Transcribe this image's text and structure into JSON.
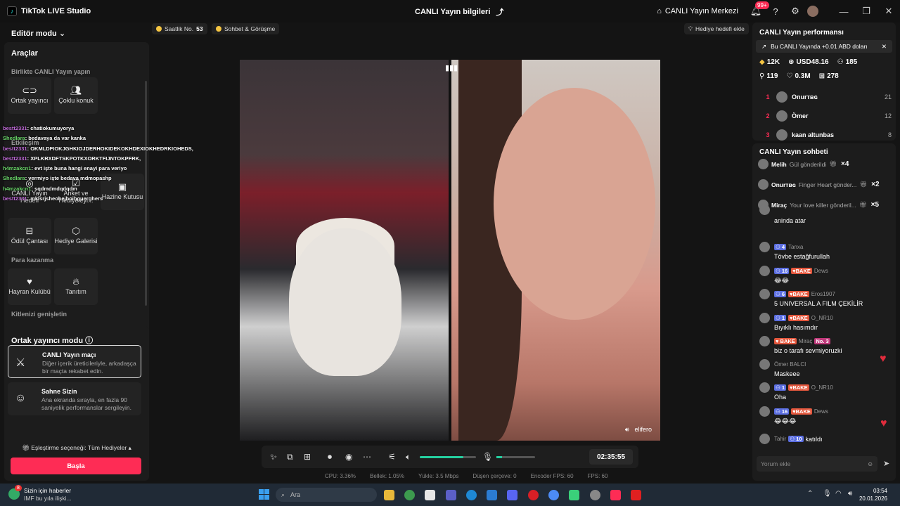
{
  "titlebar": {
    "app": "TikTok LIVE Studio",
    "center": "CANLI Yayın bilgileri",
    "live_center": "CANLI Yayın Merkezi",
    "notif_badge": "99+"
  },
  "left": {
    "mode": "Editör modu",
    "tools_title": "Araçlar",
    "sec_together": "Birlikte CANLI Yayın yapın",
    "tile_cohost": "Ortak yayıncı",
    "tile_multi": "Çoklu konuk",
    "sec_engage": "Etkileşim",
    "tile_goal": "CANLI Yayın Hedefi",
    "tile_poll": "Anket ve Hediyeleyi...",
    "tile_treasure": "Hazine Kutusu",
    "tile_reward": "Ödül Çantası",
    "tile_gallery": "Hediye Galerisi",
    "sec_money": "Para kazanma",
    "tile_fanclub": "Hayran Kulübü",
    "tile_promo": "Tanıtım",
    "sec_expand": "Kitlenizi genişletin",
    "overlay_chat": [
      {
        "user": "bestt2331",
        "text": ": chatiokumuyorya"
      },
      {
        "user": "Shedlara",
        "text": ": bedavaya da var kanka"
      },
      {
        "user": "bestt2331",
        "text": ": OKMLDFIOKJGHKIOJDERHOKIDEKOKHDEXIOKHEDRKIOHEDS,"
      },
      {
        "user": "bestt2331",
        "text": ": XPLKRXDFTSKPOTKXORKTFIJNTOKPFRK,"
      },
      {
        "user": "h4mzakcn1",
        "text": ": evt işte buna hangi enayi para veriyo"
      },
      {
        "user": "Shedlara",
        "text": ": vermiyo işte bedava mdmopashp"
      },
      {
        "user": "h4mzakcn1",
        "text": ": sqdmdmdqdqdm"
      },
      {
        "user": "bestt2331",
        "text": ": mklsrjsheohejhoihguerghers"
      }
    ],
    "coop_title": "Ortak yayıncı modu",
    "card1_title": "CANLI Yayın maçı",
    "card1_desc": "Diğer içerik üreticileriyle, arkadaşça bir maçta rekabet edin.",
    "card2_title": "Sahne Sizin",
    "card2_desc": "Ana ekranda sırayla, en fazla 90 saniyelik performanslar sergileyin.",
    "match_option": "Eşleştirme seçeneği: Tüm Hediyeler",
    "start": "Başla"
  },
  "top": {
    "hourly_label": "Saatlik No.",
    "hourly_value": "53",
    "chat_label": "Sohbet & Görüşme",
    "gift_goal": "Hediye hedefi ekle"
  },
  "video": {
    "guest_name": "elifero"
  },
  "controls": {
    "timer": "02:35:55",
    "volume": 0.78,
    "mic": 0.15
  },
  "stats": {
    "cpu": "CPU: 3.36%",
    "mem": "Bellek: 1.05%",
    "upload": "Yükle: 3.5 Mbps",
    "dropped": "Düşen çerçeve: 0",
    "enc_fps": "Encoder FPS: 60",
    "fps": "FPS: 60"
  },
  "perf": {
    "title": "CANLI Yayın performansı",
    "banner": "Bu CANLI Yayında +0.01 ABD doları",
    "diamonds": "12K",
    "usd": "USD48.16",
    "viewers": "185",
    "followers": "119",
    "likes": "0.3M",
    "shares": "278",
    "ranking": [
      {
        "rank": "1",
        "name": "Onurᴛʙɢ",
        "score": "21"
      },
      {
        "rank": "2",
        "name": "Ömer",
        "score": "12"
      },
      {
        "rank": "3",
        "name": "kaan altunbas",
        "score": "8"
      }
    ]
  },
  "chat": {
    "title": "CANLI Yayın sohbeti",
    "gifts": [
      {
        "user": "Melih",
        "text": "Gül gönderildi",
        "count": "×4"
      },
      {
        "user": "Onurᴛʙɢ",
        "text": "Finger Heart gönder...",
        "count": "×2"
      },
      {
        "user": "Miraç",
        "text": "Your love killer gönderil...",
        "count": "×5"
      }
    ],
    "messages": [
      {
        "user": "",
        "text": "aninda atar"
      },
      {
        "user": "Tanxa",
        "lv": "4",
        "text": "Tövbe estağfurullah"
      },
      {
        "user": "Dews",
        "lv": "16",
        "fb": "BAKE",
        "text": "😂😂"
      },
      {
        "user": "Eros1907",
        "lv": "6",
        "fb": "BAKE",
        "text": "5 UNIVERSAL A FILM ÇEKİLİR"
      },
      {
        "user": "O_NR10",
        "lv": "1",
        "fb": "BAKE",
        "text": "Bıyıklı hasımdır"
      },
      {
        "user": "Miraç",
        "fb": "BAKE",
        "no": "No. 3",
        "text": "biz o tarafı sevmiyoruzki"
      },
      {
        "user": "Ömer BALCI",
        "text": "Maskeee"
      },
      {
        "user": "O_NR10",
        "lv": "1",
        "fb": "BAKE",
        "text": "Oha"
      },
      {
        "user": "Dews",
        "lv": "16",
        "fb": "BAKE",
        "text": "😂😂😂"
      }
    ],
    "joined_user": "Tahir",
    "joined_lv": "10",
    "joined_text": "katıldı",
    "comment_placeholder": "Yorum ekle"
  },
  "taskbar": {
    "news_title": "Sizin için haberler",
    "news_sub": "IMF bu yıla ilişki...",
    "news_badge": "8",
    "search": "Ara",
    "time": "03:54",
    "date": "20.01.2026"
  }
}
